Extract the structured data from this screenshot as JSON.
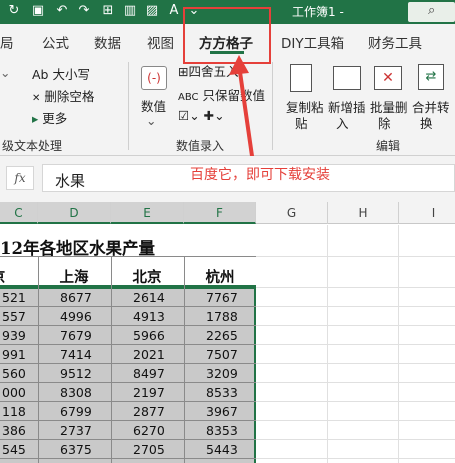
{
  "titlebar": {
    "title": "工作簿1 -",
    "quick_access": [
      "save-icon",
      "undo-icon",
      "redo-icon",
      "table-icon",
      "bar-chart-icon",
      "picture-icon",
      "text-icon",
      "dropdown-icon"
    ]
  },
  "tabs": [
    {
      "label": "局"
    },
    {
      "label": "公式"
    },
    {
      "label": "数据"
    },
    {
      "label": "视图"
    },
    {
      "label": "方方格子"
    },
    {
      "label": "DIY工具箱"
    },
    {
      "label": "财务工具"
    }
  ],
  "ribbon": {
    "text_group": {
      "items": [
        "Ab 大小写",
        "删除空格",
        "更多"
      ],
      "label": "级文本处理"
    },
    "numbers_group": {
      "numeric_label": "数值",
      "round_label": "四舍五入",
      "keep_label": "只保留数值",
      "label": "数值录入"
    },
    "edit_group": {
      "copy_label_1": "复制粘",
      "copy_label_2": "贴",
      "insert_label_1": "新增插",
      "insert_label_2": "入",
      "delete_label_1": "批量删",
      "delete_label_2": "除",
      "merge_label_1": "合并转",
      "merge_label_2": "换",
      "label": "编辑"
    }
  },
  "annotation": {
    "text": "百度它，即可下载安装"
  },
  "formula_bar": {
    "fx": "fx",
    "value": "水果"
  },
  "columns": [
    "C",
    "D",
    "E",
    "F",
    "G",
    "H",
    "I"
  ],
  "sheet": {
    "title": "12年各地区水果产量",
    "headers": [
      "京",
      "上海",
      "北京",
      "杭州"
    ],
    "rows": [
      [
        "521",
        "8677",
        "2614",
        "7767"
      ],
      [
        "557",
        "4996",
        "4913",
        "1788"
      ],
      [
        "939",
        "7679",
        "5966",
        "2265"
      ],
      [
        "991",
        "7414",
        "2021",
        "7507"
      ],
      [
        "560",
        "9512",
        "8497",
        "3209"
      ],
      [
        "000",
        "8308",
        "2197",
        "8533"
      ],
      [
        "118",
        "6799",
        "2877",
        "3967"
      ],
      [
        "386",
        "2737",
        "6270",
        "8353"
      ],
      [
        "545",
        "6375",
        "2705",
        "5443"
      ]
    ]
  },
  "colors": {
    "accent": "#217346",
    "annotation": "#e5403a"
  }
}
